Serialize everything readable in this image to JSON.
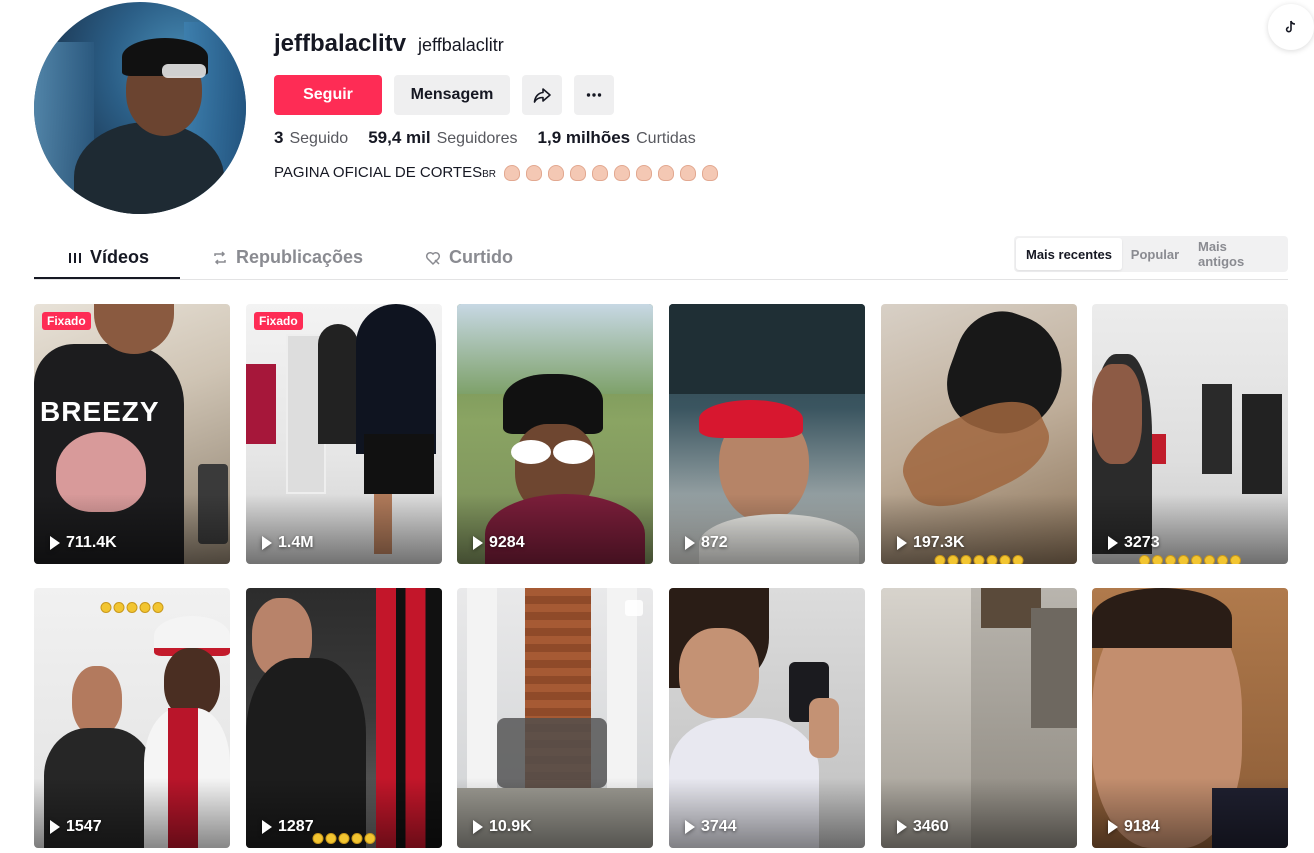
{
  "profile": {
    "username": "jeffbalaclitv",
    "nickname": "jeffbalaclitr",
    "bio_text": "PAGINA OFICIAL DE CORTES",
    "bio_small": "BR",
    "bio_emoji_count": 10
  },
  "actions": {
    "follow_label": "Seguir",
    "message_label": "Mensagem",
    "share_icon": "share-icon",
    "more_icon": "more-icon"
  },
  "stats": {
    "following_count": "3",
    "following_label": "Seguido",
    "followers_count": "59,4 mil",
    "followers_label": "Seguidores",
    "likes_count": "1,9 milhões",
    "likes_label": "Curtidas"
  },
  "tabs": [
    {
      "label": "Vídeos",
      "icon": "grid-icon",
      "active": true
    },
    {
      "label": "Republicações",
      "icon": "repost-icon",
      "active": false
    },
    {
      "label": "Curtido",
      "icon": "liked-icon",
      "active": false
    }
  ],
  "sort_options": [
    {
      "label": "Mais recentes",
      "active": true
    },
    {
      "label": "Popular",
      "active": false
    },
    {
      "label": "Mais antigos",
      "active": false
    }
  ],
  "videos": [
    {
      "views": "711.4K",
      "pinned": "Fixado"
    },
    {
      "views": "1.4M",
      "pinned": "Fixado"
    },
    {
      "views": "9284"
    },
    {
      "views": "872"
    },
    {
      "views": "197.3K"
    },
    {
      "views": "3273"
    },
    {
      "views": "1547"
    },
    {
      "views": "1287"
    },
    {
      "views": "10.9K"
    },
    {
      "views": "3744"
    },
    {
      "views": "3460"
    },
    {
      "views": "9184"
    }
  ],
  "colors": {
    "brand": "#fe2c55",
    "text": "#161823",
    "muted": "#8a8b91"
  }
}
